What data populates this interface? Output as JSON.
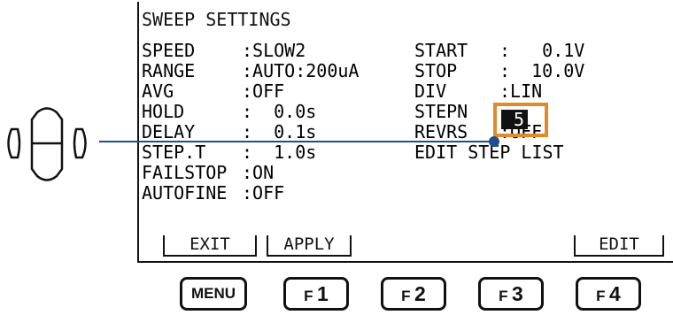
{
  "screen": {
    "title": "SWEEP SETTINGS",
    "left_rows": [
      {
        "label": "SPEED",
        "value": ":SLOW2"
      },
      {
        "label": "RANGE",
        "value": ":AUTO:200uA"
      },
      {
        "label": "AVG",
        "value": ":OFF"
      },
      {
        "label": "HOLD",
        "value": ":  0.0s"
      },
      {
        "label": "DELAY",
        "value": ":  0.1s"
      },
      {
        "label": "STEP.T",
        "value": ":  1.0s"
      },
      {
        "label": "FAILSTOP",
        "value": ":ON"
      },
      {
        "label": "AUTOFINE",
        "value": ":OFF"
      }
    ],
    "right_rows": [
      {
        "label": "START",
        "value": ":   0.1V"
      },
      {
        "label": "STOP",
        "value": ":  10.0V"
      },
      {
        "label": "DIV",
        "value": ":LIN"
      },
      {
        "label": "STEPN",
        "value": ""
      },
      {
        "label": "REVRS",
        "value": ":OFF"
      },
      {
        "label": "EDIT STEP LIST",
        "value": ""
      }
    ],
    "stepn_value": "5",
    "softkeys": {
      "f1": "EXIT",
      "f2": "APPLY",
      "f4": "EDIT"
    }
  },
  "buttons": {
    "menu": "MENU",
    "f1_name": "F",
    "f1_num": "1",
    "f2_name": "F",
    "f2_num": "2",
    "f3_name": "F",
    "f3_num": "3",
    "f4_name": "F",
    "f4_num": "4"
  },
  "colors": {
    "highlight": "#e08a2a",
    "pointer": "#1f4e8c"
  },
  "icons": {
    "dpad": "navigation-dpad-icon"
  }
}
